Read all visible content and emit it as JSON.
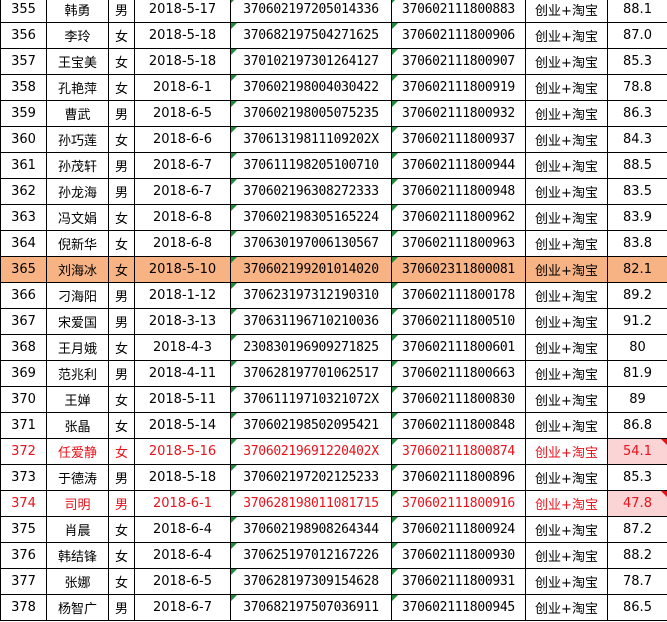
{
  "colors": {
    "highlight_row": "#f7b383",
    "red_text": "#e8121b",
    "pink_fill": "#fbd4d5",
    "indicator_green": "#1f8a3a"
  },
  "rows": [
    {
      "no": "355",
      "name": "韩勇",
      "sex": "男",
      "date": "2018-5-17",
      "id": "370602197205014336",
      "acct": "370602111800883",
      "major": "创业+淘宝",
      "score": "88.1"
    },
    {
      "no": "356",
      "name": "李玲",
      "sex": "女",
      "date": "2018-5-18",
      "id": "370682197504271625",
      "acct": "370602111800906",
      "major": "创业+淘宝",
      "score": "87.0"
    },
    {
      "no": "357",
      "name": "王宝美",
      "sex": "女",
      "date": "2018-5-18",
      "id": "370102197301264127",
      "acct": "370602111800907",
      "major": "创业+淘宝",
      "score": "85.3"
    },
    {
      "no": "358",
      "name": "孔艳萍",
      "sex": "女",
      "date": "2018-6-1",
      "id": "370602198004030422",
      "acct": "370602111800919",
      "major": "创业+淘宝",
      "score": "78.8"
    },
    {
      "no": "359",
      "name": "曹武",
      "sex": "男",
      "date": "2018-6-5",
      "id": "370602198005075235",
      "acct": "370602111800932",
      "major": "创业+淘宝",
      "score": "86.3"
    },
    {
      "no": "360",
      "name": "孙巧莲",
      "sex": "女",
      "date": "2018-6-6",
      "id": "37061319811109202X",
      "acct": "370602111800937",
      "major": "创业+淘宝",
      "score": "84.3"
    },
    {
      "no": "361",
      "name": "孙茂轩",
      "sex": "男",
      "date": "2018-6-7",
      "id": "370611198205100710",
      "acct": "370602111800944",
      "major": "创业+淘宝",
      "score": "88.5"
    },
    {
      "no": "362",
      "name": "孙龙海",
      "sex": "男",
      "date": "2018-6-7",
      "id": "370602196308272333",
      "acct": "370602111800948",
      "major": "创业+淘宝",
      "score": "83.5"
    },
    {
      "no": "363",
      "name": "冯文娟",
      "sex": "女",
      "date": "2018-6-8",
      "id": "370602198305165224",
      "acct": "370602111800962",
      "major": "创业+淘宝",
      "score": "83.9"
    },
    {
      "no": "364",
      "name": "倪新华",
      "sex": "女",
      "date": "2018-6-8",
      "id": "370630197006130567",
      "acct": "370602111800963",
      "major": "创业+淘宝",
      "score": "83.8"
    },
    {
      "no": "365",
      "name": "刘海冰",
      "sex": "女",
      "date": "2018-5-10",
      "id": "370602199201014020",
      "acct": "370602311800081",
      "major": "创业+淘宝",
      "score": "82.1",
      "style": "hl"
    },
    {
      "no": "366",
      "name": "刁海阳",
      "sex": "男",
      "date": "2018-1-12",
      "id": "370623197312190310",
      "acct": "370602111800178",
      "major": "创业+淘宝",
      "score": "89.2"
    },
    {
      "no": "367",
      "name": "宋爱国",
      "sex": "男",
      "date": "2018-3-13",
      "id": "370631196710210036",
      "acct": "370602111800510",
      "major": "创业+淘宝",
      "score": "91.2"
    },
    {
      "no": "368",
      "name": "王月娥",
      "sex": "女",
      "date": "2018-4-3",
      "id": "230830196909271825",
      "acct": "370602111800601",
      "major": "创业+淘宝",
      "score": "80"
    },
    {
      "no": "369",
      "name": "范兆利",
      "sex": "男",
      "date": "2018-4-11",
      "id": "370628197701062517",
      "acct": "370602111800663",
      "major": "创业+淘宝",
      "score": "81.9"
    },
    {
      "no": "370",
      "name": "王婵",
      "sex": "女",
      "date": "2018-5-11",
      "id": "37061119710321072X",
      "acct": "370602111800830",
      "major": "创业+淘宝",
      "score": "89"
    },
    {
      "no": "371",
      "name": "张晶",
      "sex": "女",
      "date": "2018-5-14",
      "id": "370602198502095421",
      "acct": "370602111800848",
      "major": "创业+淘宝",
      "score": "86.8"
    },
    {
      "no": "372",
      "name": "任爱静",
      "sex": "女",
      "date": "2018-5-16",
      "id": "37060219691220402X",
      "acct": "370602111800874",
      "major": "创业+淘宝",
      "score": "54.1",
      "style": "red"
    },
    {
      "no": "373",
      "name": "于德涛",
      "sex": "男",
      "date": "2018-5-18",
      "id": "370602197202125233",
      "acct": "370602111800896",
      "major": "创业+淘宝",
      "score": "85.3"
    },
    {
      "no": "374",
      "name": "司明",
      "sex": "男",
      "date": "2018-6-1",
      "id": "370628198011081715",
      "acct": "370602111800916",
      "major": "创业+淘宝",
      "score": "47.8",
      "style": "red"
    },
    {
      "no": "375",
      "name": "肖晨",
      "sex": "女",
      "date": "2018-6-4",
      "id": "370602198908264344",
      "acct": "370602111800924",
      "major": "创业+淘宝",
      "score": "87.2"
    },
    {
      "no": "376",
      "name": "韩结锋",
      "sex": "女",
      "date": "2018-6-4",
      "id": "370625197012167226",
      "acct": "370602111800930",
      "major": "创业+淘宝",
      "score": "88.2"
    },
    {
      "no": "377",
      "name": "张娜",
      "sex": "女",
      "date": "2018-6-5",
      "id": "370628197309154628",
      "acct": "370602111800931",
      "major": "创业+淘宝",
      "score": "78.7"
    },
    {
      "no": "378",
      "name": "杨智广",
      "sex": "男",
      "date": "2018-6-7",
      "id": "370682197507036911",
      "acct": "370602111800945",
      "major": "创业+淘宝",
      "score": "86.5"
    }
  ]
}
